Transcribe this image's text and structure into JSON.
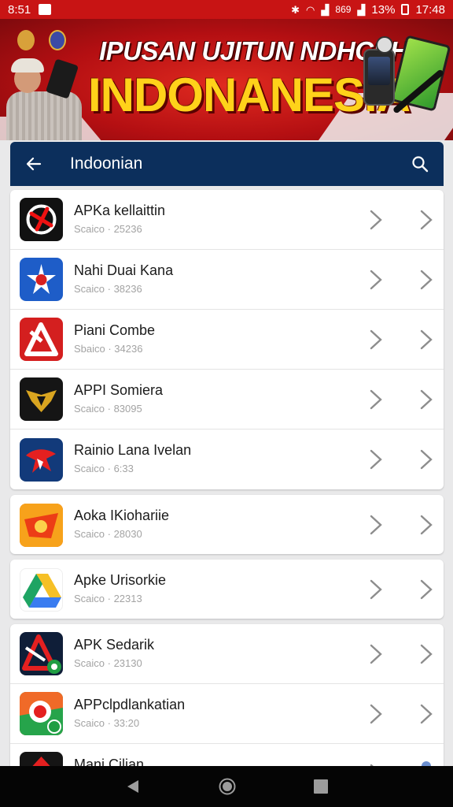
{
  "status_bar": {
    "left_text": "8:51",
    "signal_text": "869",
    "battery": "13%",
    "time": "17:48"
  },
  "banner": {
    "line1": "IPUSAN UJITUN NDHCSHI",
    "line2": "INDONANESIA"
  },
  "app_bar": {
    "title": "Indoonian",
    "back_icon": "arrow-left-icon",
    "search_icon": "search-icon"
  },
  "apps": [
    {
      "name": "APKa kellaittin",
      "meta": "Scaico · 25236",
      "icon": "compass-icon",
      "bg": "#111111"
    },
    {
      "name": "Nahi Duai Kana",
      "meta": "Scaico · 38236",
      "icon": "star-emblem-icon",
      "bg": "#1e5dc8"
    },
    {
      "name": "Piani Combe",
      "meta": "Sbaico · 34236",
      "icon": "triangle-a-icon",
      "bg": "#d41f1f"
    },
    {
      "name": "APPI Somiera",
      "meta": "Scaico · 83095",
      "icon": "gold-crest-icon",
      "bg": "#151515"
    },
    {
      "name": "Rainio Lana Ivelan",
      "meta": "Scaico · 6:33",
      "icon": "red-bird-icon",
      "bg": "#123a7a"
    },
    {
      "name": "Aoka IKiohariie",
      "meta": "Scaico · 28030",
      "icon": "orange-disc-icon",
      "bg": "#f15b17"
    },
    {
      "name": "Apke Urisorkie",
      "meta": "Scaico · 22313",
      "icon": "drive-icon",
      "bg": "#ffffff"
    },
    {
      "name": "APK Sedarik",
      "meta": "Scaico · 23130",
      "icon": "red-a-badge-icon",
      "bg": "#0f1e38"
    },
    {
      "name": "APPclpdlankatian",
      "meta": "Scaico · 33:20",
      "icon": "chat-badge-icon",
      "bg": "#26a44b"
    },
    {
      "name": "Mani Cilian",
      "meta": "",
      "icon": "red-arrow-icon",
      "bg": "#151515"
    }
  ],
  "nav": {
    "back": "triangle-back-icon",
    "home": "circle-home-icon",
    "recents": "square-recents-icon"
  }
}
